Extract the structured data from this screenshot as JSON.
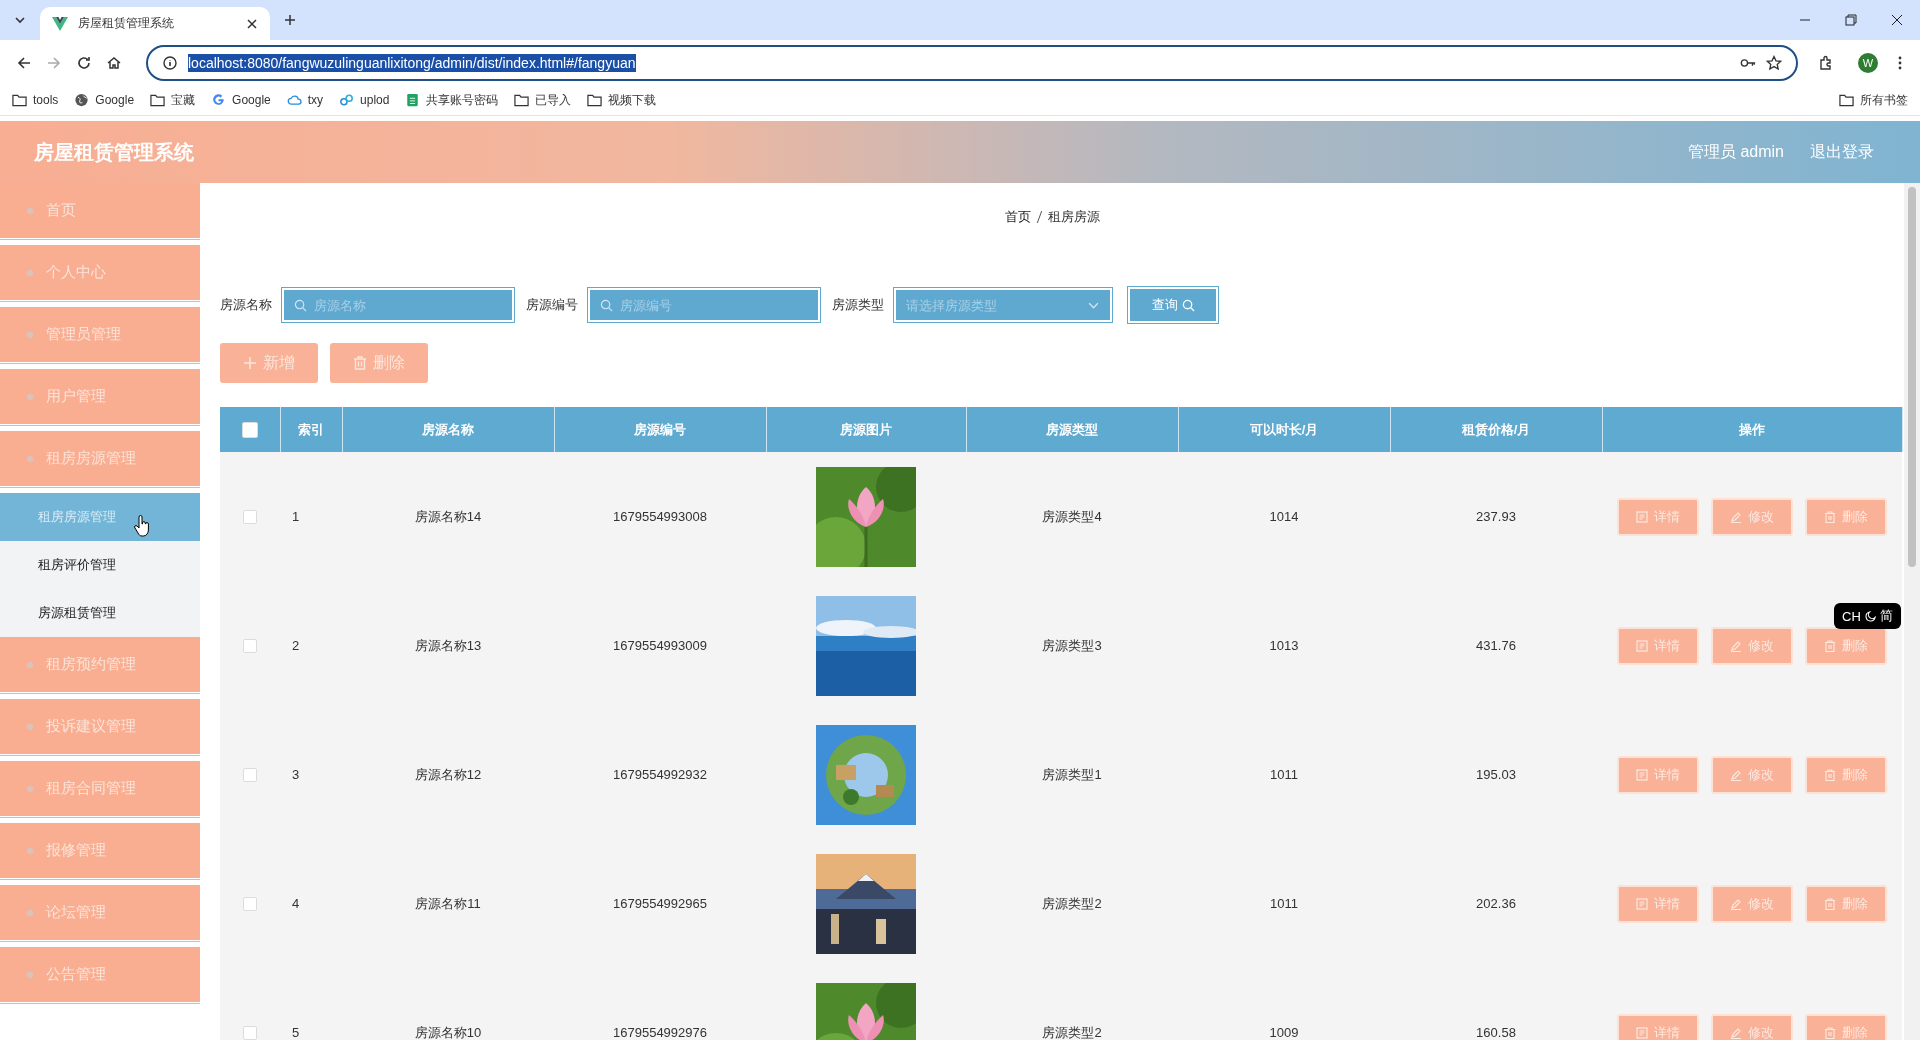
{
  "browser": {
    "tab_title": "房屋租赁管理系统",
    "url": "localhost:8080/fangwuzulinguanlixitong/admin/dist/index.html#/fangyuan",
    "profile_initial": "W",
    "bookmarks": [
      {
        "label": "tools",
        "kind": "folder"
      },
      {
        "label": "Google",
        "kind": "globe"
      },
      {
        "label": "宝藏",
        "kind": "folder"
      },
      {
        "label": "Google",
        "kind": "g"
      },
      {
        "label": "txy",
        "kind": "cloud"
      },
      {
        "label": "uplod",
        "kind": "link"
      },
      {
        "label": "共享账号密码",
        "kind": "sheet"
      },
      {
        "label": "已导入",
        "kind": "folder"
      },
      {
        "label": "视频下载",
        "kind": "folder"
      }
    ],
    "all_bookmarks": "所有书签"
  },
  "header": {
    "title": "房屋租赁管理系统",
    "user": "管理员 admin",
    "logout": "退出登录"
  },
  "sidebar": {
    "items": [
      {
        "label": "首页",
        "selected": false
      },
      {
        "label": "个人中心",
        "selected": false
      },
      {
        "label": "管理员管理",
        "selected": false
      },
      {
        "label": "用户管理",
        "selected": false
      },
      {
        "label": "租房房源管理",
        "selected": false,
        "expanded": true,
        "children": [
          {
            "label": "租房房源管理",
            "selected": true
          },
          {
            "label": "租房评价管理",
            "selected": false
          },
          {
            "label": "房源租赁管理",
            "selected": false
          }
        ]
      },
      {
        "label": "租房预约管理",
        "selected": false
      },
      {
        "label": "投诉建议管理",
        "selected": false
      },
      {
        "label": "租房合同管理",
        "selected": false
      },
      {
        "label": "报修管理",
        "selected": false
      },
      {
        "label": "论坛管理",
        "selected": false
      },
      {
        "label": "公告管理",
        "selected": false
      }
    ]
  },
  "breadcrumb": [
    "首页",
    "租房房源"
  ],
  "search": {
    "fields": [
      {
        "label": "房源名称",
        "placeholder": "房源名称",
        "kind": "text"
      },
      {
        "label": "房源编号",
        "placeholder": "房源编号",
        "kind": "text"
      },
      {
        "label": "房源类型",
        "placeholder": "请选择房源类型",
        "kind": "select"
      }
    ],
    "button": "查询"
  },
  "actions": [
    "新增",
    "删除"
  ],
  "table": {
    "header_checked": false,
    "columns": [
      "索引",
      "房源名称",
      "房源编号",
      "房源图片",
      "房源类型",
      "可以时长/月",
      "租赁价格/月",
      "操作"
    ],
    "rows": [
      {
        "checked": false,
        "index": "1",
        "name": "房源名称14",
        "code": "1679554993008",
        "type": "房源类型4",
        "duration": "1014",
        "price": "237.93",
        "actions": [
          "详情",
          "修改",
          "删除"
        ]
      },
      {
        "checked": false,
        "index": "2",
        "name": "房源名称13",
        "code": "1679554993009",
        "type": "房源类型3",
        "duration": "1013",
        "price": "431.76",
        "actions": [
          "详情",
          "修改",
          "删除"
        ]
      },
      {
        "checked": false,
        "index": "3",
        "name": "房源名称12",
        "code": "1679554992932",
        "type": "房源类型1",
        "duration": "1011",
        "price": "195.03",
        "actions": [
          "详情",
          "修改",
          "删除"
        ]
      },
      {
        "checked": false,
        "index": "4",
        "name": "房源名称11",
        "code": "1679554992965",
        "type": "房源类型2",
        "duration": "1011",
        "price": "202.36",
        "actions": [
          "详情",
          "修改",
          "删除"
        ]
      },
      {
        "checked": false,
        "index": "5",
        "name": "房源名称10",
        "code": "1679554992976",
        "type": "房源类型2",
        "duration": "1009",
        "price": "160.58",
        "actions": [
          "详情",
          "修改",
          "删除"
        ]
      }
    ]
  },
  "ime_indicator": {
    "mode": "CH",
    "script": "简"
  }
}
